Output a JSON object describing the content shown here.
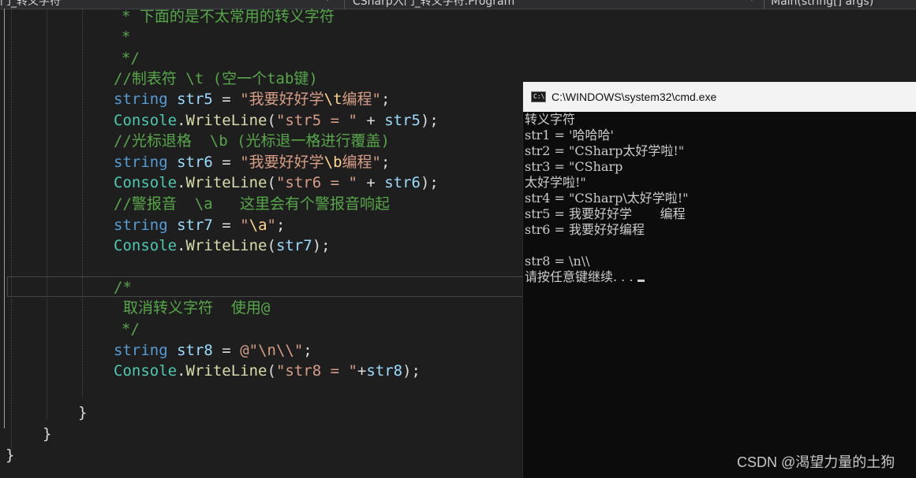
{
  "navbar": {
    "project": "门_转义字符",
    "class_scope": "CSharp入门_转义字符.Program",
    "member_scope": "Main(string[] args)"
  },
  "editor": {
    "lines": [
      {
        "tokens": [
          {
            "c": "cmt",
            "t": "* 下面的是不太常用的转义字符"
          }
        ]
      },
      {
        "tokens": [
          {
            "c": "cmt",
            "t": "*"
          }
        ]
      },
      {
        "tokens": [
          {
            "c": "cmt",
            "t": "*/"
          }
        ]
      },
      {
        "tokens": [
          {
            "c": "cmt",
            "t": "//制表符 \\t (空一个tab键)"
          }
        ]
      },
      {
        "tokens": [
          {
            "c": "kw",
            "t": "string"
          },
          {
            "c": "pl",
            "t": " "
          },
          {
            "c": "id",
            "t": "str5"
          },
          {
            "c": "pl",
            "t": " = "
          },
          {
            "c": "str",
            "t": "\"我要好好学"
          },
          {
            "c": "esc",
            "t": "\\t"
          },
          {
            "c": "str",
            "t": "编程\""
          },
          {
            "c": "pl",
            "t": ";"
          }
        ]
      },
      {
        "tokens": [
          {
            "c": "ty",
            "t": "Console"
          },
          {
            "c": "pl",
            "t": "."
          },
          {
            "c": "fn",
            "t": "WriteLine"
          },
          {
            "c": "pl",
            "t": "("
          },
          {
            "c": "str",
            "t": "\"str5 = \""
          },
          {
            "c": "pl",
            "t": " + "
          },
          {
            "c": "id",
            "t": "str5"
          },
          {
            "c": "pl",
            "t": ");"
          }
        ]
      },
      {
        "tokens": [
          {
            "c": "cmt",
            "t": "//光标退格  \\b (光标退一格进行覆盖)"
          }
        ]
      },
      {
        "tokens": [
          {
            "c": "kw",
            "t": "string"
          },
          {
            "c": "pl",
            "t": " "
          },
          {
            "c": "id",
            "t": "str6"
          },
          {
            "c": "pl",
            "t": " = "
          },
          {
            "c": "str",
            "t": "\"我要好好学"
          },
          {
            "c": "esc",
            "t": "\\b"
          },
          {
            "c": "str",
            "t": "编程\""
          },
          {
            "c": "pl",
            "t": ";"
          }
        ]
      },
      {
        "tokens": [
          {
            "c": "ty",
            "t": "Console"
          },
          {
            "c": "pl",
            "t": "."
          },
          {
            "c": "fn",
            "t": "WriteLine"
          },
          {
            "c": "pl",
            "t": "("
          },
          {
            "c": "str",
            "t": "\"str6 = \""
          },
          {
            "c": "pl",
            "t": " + "
          },
          {
            "c": "id",
            "t": "str6"
          },
          {
            "c": "pl",
            "t": ");"
          }
        ]
      },
      {
        "tokens": [
          {
            "c": "cmt",
            "t": "//警报音  \\a   这里会有个警报音响起"
          }
        ]
      },
      {
        "tokens": [
          {
            "c": "kw",
            "t": "string"
          },
          {
            "c": "pl",
            "t": " "
          },
          {
            "c": "id",
            "t": "str7"
          },
          {
            "c": "pl",
            "t": " = "
          },
          {
            "c": "str",
            "t": "\""
          },
          {
            "c": "esc",
            "t": "\\a"
          },
          {
            "c": "str",
            "t": "\""
          },
          {
            "c": "pl",
            "t": ";"
          }
        ]
      },
      {
        "tokens": [
          {
            "c": "ty",
            "t": "Console"
          },
          {
            "c": "pl",
            "t": "."
          },
          {
            "c": "fn",
            "t": "WriteLine"
          },
          {
            "c": "pl",
            "t": "("
          },
          {
            "c": "id",
            "t": "str7"
          },
          {
            "c": "pl",
            "t": ");"
          }
        ]
      },
      {
        "tokens": []
      },
      {
        "tokens": [
          {
            "c": "cmt",
            "t": "/*"
          }
        ]
      },
      {
        "tokens": [
          {
            "c": "cmt",
            "t": "取消转义字符  使用@"
          }
        ]
      },
      {
        "tokens": [
          {
            "c": "cmt",
            "t": "*/"
          }
        ]
      },
      {
        "tokens": [
          {
            "c": "kw",
            "t": "string"
          },
          {
            "c": "pl",
            "t": " "
          },
          {
            "c": "id",
            "t": "str8"
          },
          {
            "c": "pl",
            "t": " = "
          },
          {
            "c": "str",
            "t": "@\"\\n\\\\\""
          },
          {
            "c": "pl",
            "t": ";"
          }
        ]
      },
      {
        "tokens": [
          {
            "c": "ty",
            "t": "Console"
          },
          {
            "c": "pl",
            "t": "."
          },
          {
            "c": "fn",
            "t": "WriteLine"
          },
          {
            "c": "pl",
            "t": "("
          },
          {
            "c": "str",
            "t": "\"str8 = \""
          },
          {
            "c": "pl",
            "t": "+"
          },
          {
            "c": "id",
            "t": "str8"
          },
          {
            "c": "pl",
            "t": ");"
          }
        ]
      },
      {
        "tokens": []
      },
      {
        "tokens": [
          {
            "c": "pl",
            "t": "}"
          }
        ]
      },
      {
        "tokens": [
          {
            "c": "pl",
            "t": "}"
          }
        ]
      },
      {
        "tokens": [
          {
            "c": "pl",
            "t": "}"
          }
        ]
      }
    ]
  },
  "cmd": {
    "title": "C:\\WINDOWS\\system32\\cmd.exe",
    "icon_label": "C:\\",
    "output": [
      "转义字符",
      "str1 = '哈哈哈'",
      "str2 = \"CSharp太好学啦!\"",
      "str3 = \"CSharp",
      "太好学啦!\"",
      "str4 = \"CSharp\\太好学啦!\"",
      "str5 = 我要好好学       编程",
      "str6 = 我要好好编程",
      "",
      "str8 = \\n\\\\",
      "请按任意键继续. . ."
    ]
  },
  "watermark": "CSDN @渴望力量的土狗"
}
